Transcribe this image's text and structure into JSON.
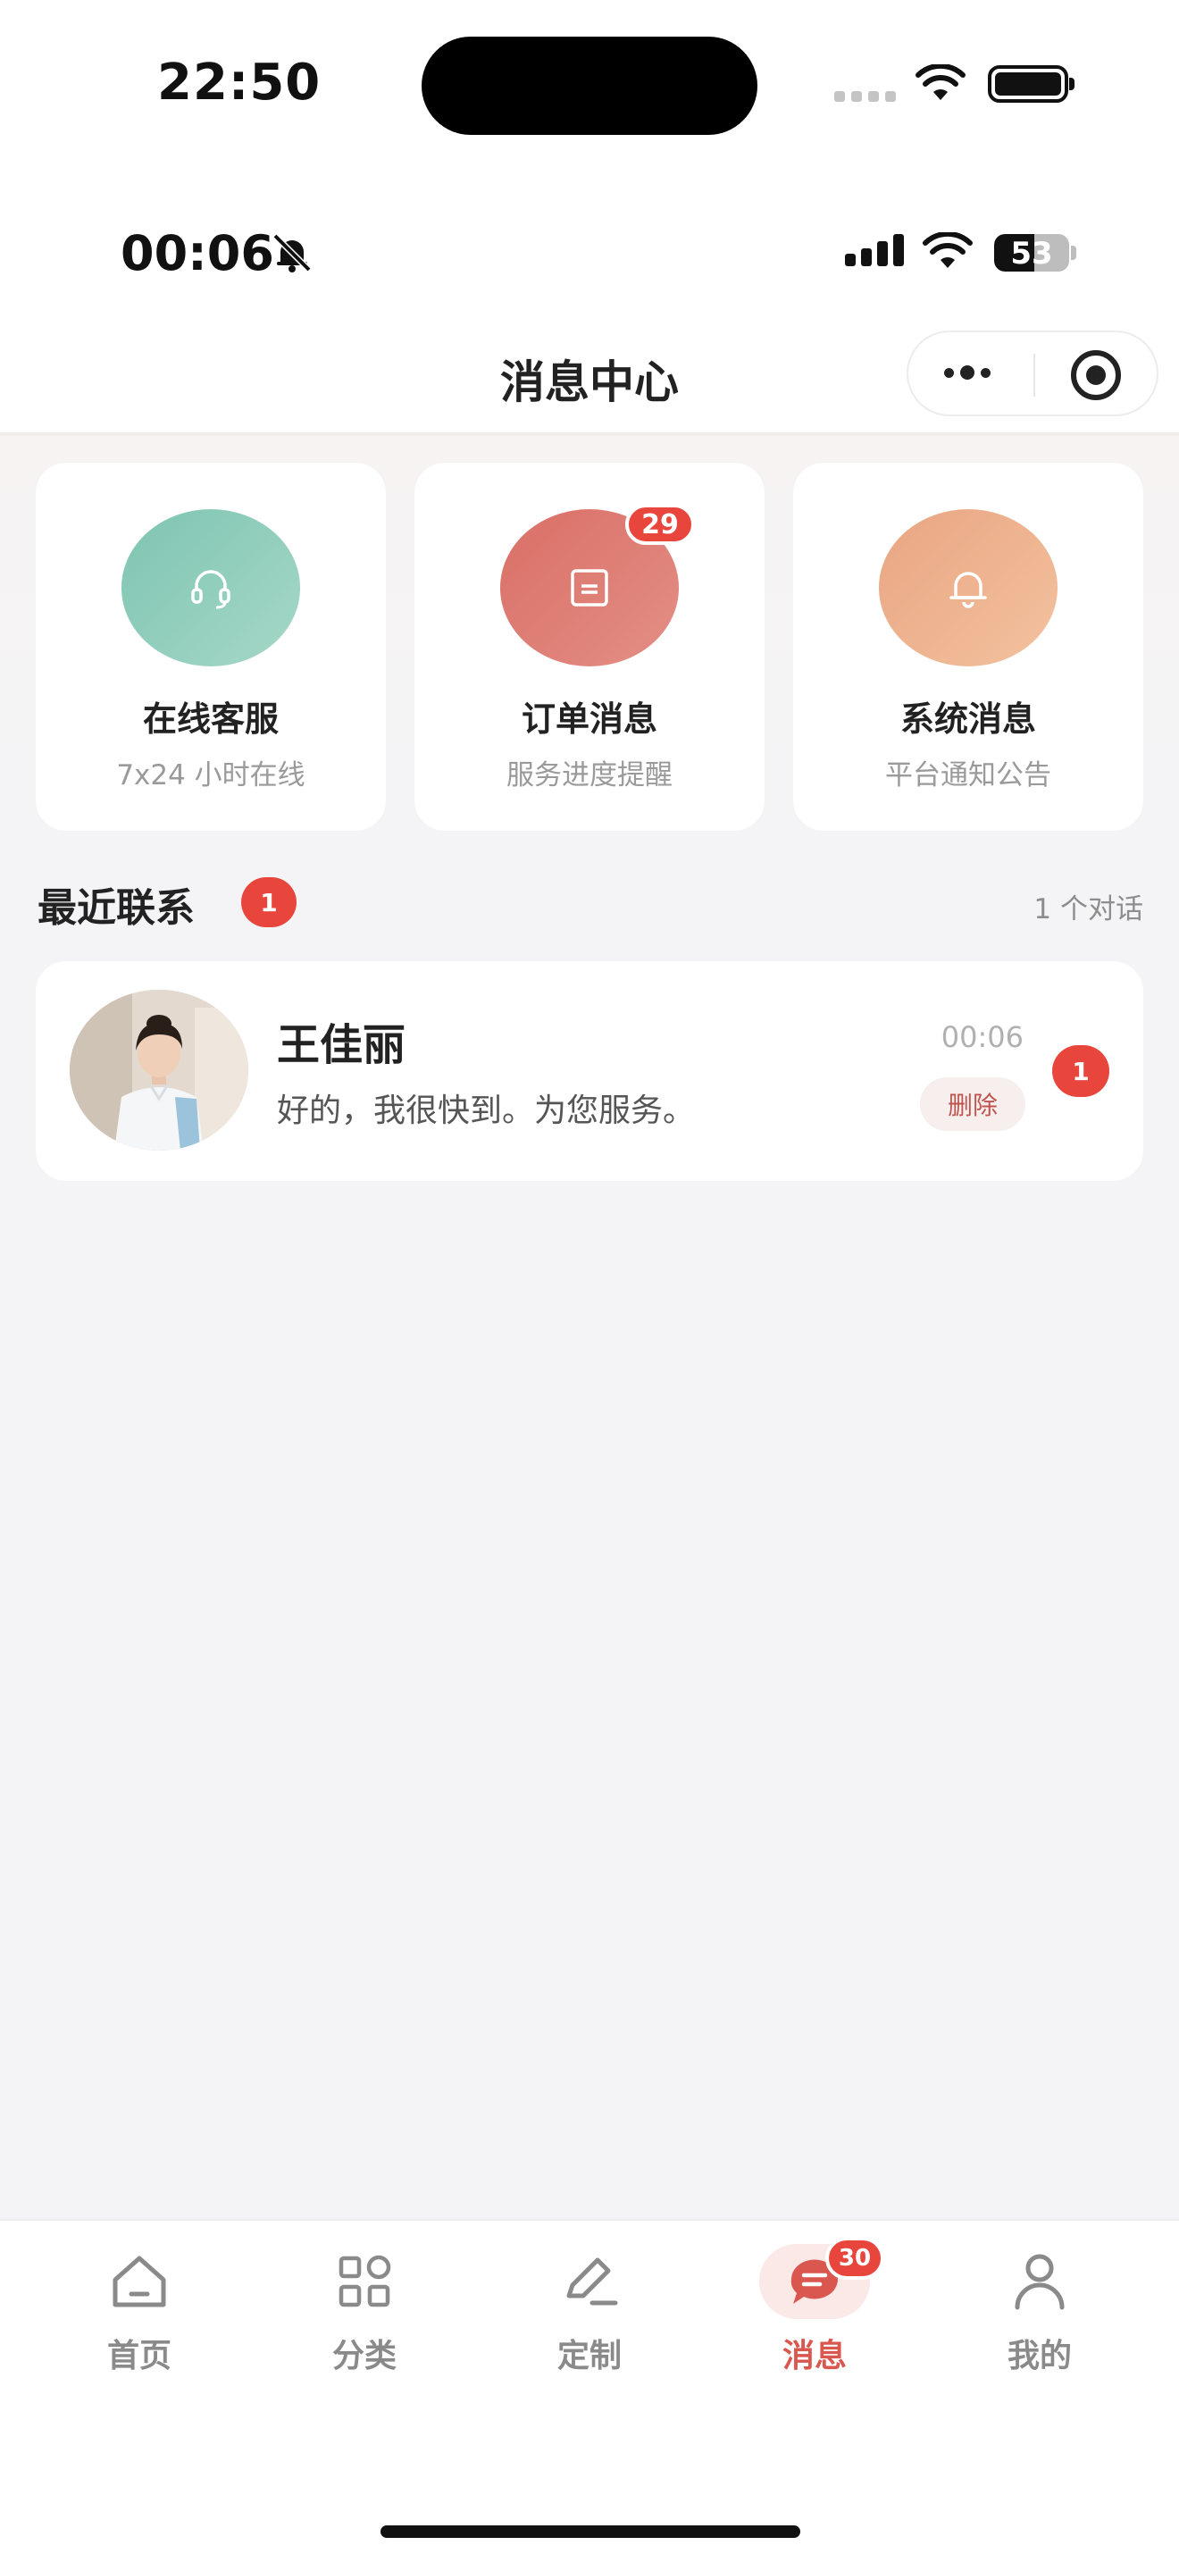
{
  "status_outer": {
    "time": "22:50"
  },
  "status_inner": {
    "time": "00:06",
    "battery": "53",
    "battery_level": 0.53
  },
  "nav": {
    "title": "消息中心"
  },
  "quick_actions": [
    {
      "title": "在线客服",
      "subtitle": "7x24 小时在线",
      "icon": "headset-icon",
      "color": "#8ccbb9"
    },
    {
      "title": "订单消息",
      "subtitle": "服务进度提醒",
      "icon": "order-icon",
      "color": "#dd7b72",
      "badge": "29"
    },
    {
      "title": "系统消息",
      "subtitle": "平台通知公告",
      "icon": "bell-icon",
      "color": "#eeb28e"
    }
  ],
  "recent": {
    "title": "最近联系",
    "badge": "1",
    "count_label": "1 个对话",
    "conversations": [
      {
        "name": "王佳丽",
        "message": "好的，我很快到。为您服务。",
        "time": "00:06",
        "delete_label": "删除",
        "unread": "1"
      }
    ]
  },
  "tabbar": {
    "items": [
      {
        "label": "首页",
        "icon": "home-icon"
      },
      {
        "label": "分类",
        "icon": "grid-icon"
      },
      {
        "label": "定制",
        "icon": "edit-icon"
      },
      {
        "label": "消息",
        "icon": "message-icon",
        "badge": "30",
        "active": true
      },
      {
        "label": "我的",
        "icon": "user-icon"
      }
    ]
  },
  "colors": {
    "accent": "#d9574f",
    "badge": "#e8453c"
  }
}
